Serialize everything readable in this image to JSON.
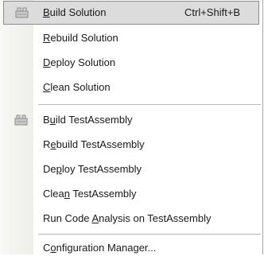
{
  "menu": {
    "items": [
      {
        "pre": "",
        "key": "B",
        "post": "uild Solution",
        "shortcut": "Ctrl+Shift+B",
        "icon": "build-solution-icon"
      },
      {
        "pre": "",
        "key": "R",
        "post": "ebuild Solution"
      },
      {
        "pre": "",
        "key": "D",
        "post": "eploy Solution"
      },
      {
        "pre": "",
        "key": "C",
        "post": "lean Solution"
      },
      {
        "pre": "B",
        "key": "u",
        "post": "ild TestAssembly",
        "icon": "build-project-icon"
      },
      {
        "pre": "R",
        "key": "e",
        "post": "build TestAssembly"
      },
      {
        "pre": "De",
        "key": "p",
        "post": "loy TestAssembly"
      },
      {
        "pre": "Clea",
        "key": "n",
        "post": " TestAssembly"
      },
      {
        "pre": "Run Code ",
        "key": "A",
        "post": "nalysis on TestAssembly"
      },
      {
        "pre": "C",
        "key": "o",
        "post": "nfiguration Manager..."
      }
    ]
  },
  "colors": {
    "highlight_bg": "#dcdcdc",
    "highlight_border": "#8d8d8d",
    "separator": "#b8b8b8",
    "gutter": "#f2f2ef"
  }
}
